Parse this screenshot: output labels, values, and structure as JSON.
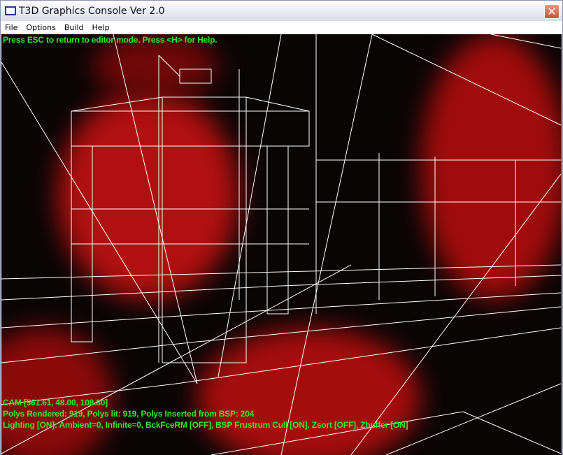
{
  "window": {
    "title": "T3D Graphics Console Ver 2.0",
    "close_icon": "close-icon"
  },
  "menu": [
    "File",
    "Options",
    "Build",
    "Help"
  ],
  "hud": {
    "help": "Press ESC to return to editor mode. Press <H> for Help.",
    "cam": "CAM [561.61, 48.00, 108.80]",
    "polys": "Polys Rendered: 919, Polys lit: 919, Polys Inserted from BSP: 204",
    "lighting": "Lighting [ON]: Ambient=0, Infinite=0, BckFceRM [OFF], BSP Frustrum Cull [ON], Zsort [OFF], Zbuffer [ON]"
  },
  "colors": {
    "hud_text": "#2ee82e",
    "wireframe": "#ffffff",
    "fog": "#c01010"
  }
}
